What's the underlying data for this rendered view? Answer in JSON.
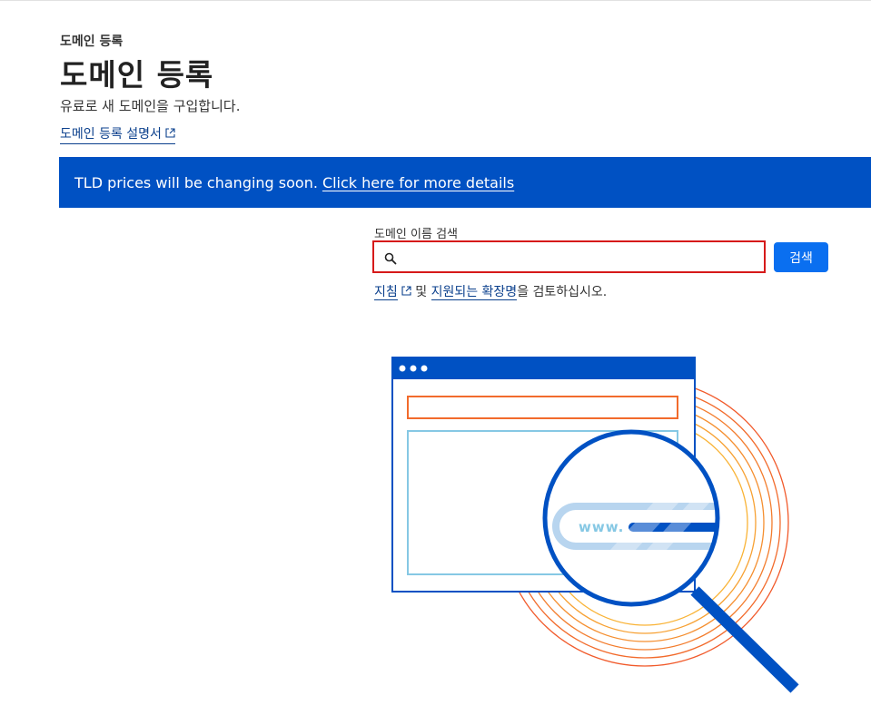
{
  "header": {
    "breadcrumb": "도메인 등록",
    "title": "도메인 등록",
    "subtitle": "유료로 새 도메인을 구입합니다.",
    "guide_link": "도메인 등록 설명서"
  },
  "banner": {
    "text": "TLD prices will be changing soon.",
    "link": "Click here for more details"
  },
  "search": {
    "label": "도메인 이름 검색",
    "value": "",
    "button_label": "검색"
  },
  "help": {
    "policy_link": "지침",
    "and": "및",
    "extensions_link": "지원되는 확장명",
    "suffix": "을 검토하십시오."
  },
  "illustration": {
    "magnifier_text": "www."
  },
  "colors": {
    "brand_blue": "#0051c3",
    "button_blue": "#0a6ff0",
    "error_red": "#d61a1a"
  }
}
